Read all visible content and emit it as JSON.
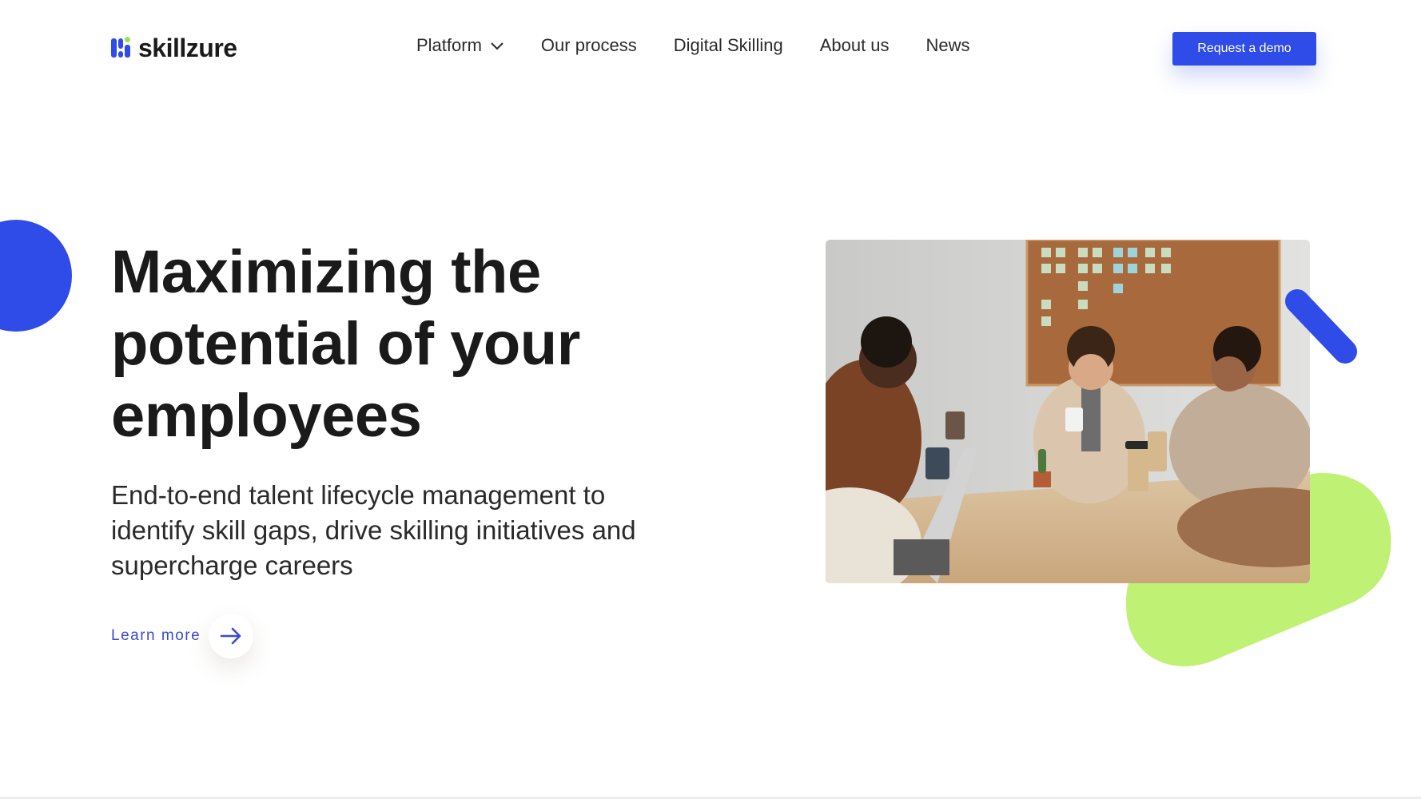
{
  "brand": {
    "name": "skillzure",
    "logo_icon": "skillzure-bars-logo",
    "primary_color": "#2f4ce8",
    "accent_color": "#bff274"
  },
  "nav": {
    "items": [
      {
        "label": "Platform",
        "has_dropdown": true,
        "icon": "chevron-down-icon"
      },
      {
        "label": "Our process"
      },
      {
        "label": "Digital Skilling"
      },
      {
        "label": "About us"
      },
      {
        "label": "News"
      }
    ],
    "cta_label": "Request a demo"
  },
  "hero": {
    "title": "Maximizing the potential of your employees",
    "subtitle": "End-to-end talent lifecycle management to identify skill gaps, drive skilling initiatives and supercharge careers",
    "learn_more_label": "Learn more",
    "learn_more_icon": "arrow-right-icon",
    "image_alt": "Team meeting around a table with coffee cups, laptops and a corkboard with sticky notes"
  }
}
